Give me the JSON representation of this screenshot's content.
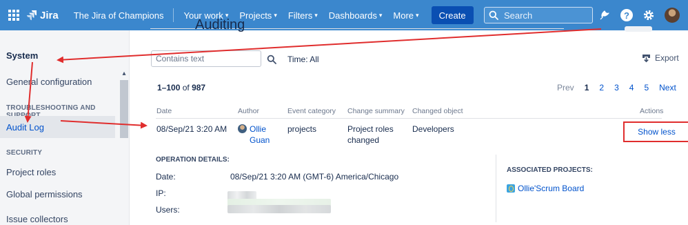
{
  "topnav": {
    "product": "Jira",
    "site_title": "The Jira of Champions",
    "menu": [
      {
        "label": "Your work"
      },
      {
        "label": "Projects"
      },
      {
        "label": "Filters"
      },
      {
        "label": "Dashboards"
      },
      {
        "label": "More"
      }
    ],
    "create_label": "Create",
    "search_placeholder": "Search",
    "icons": [
      "apps-grid-icon",
      "jira-logo-icon",
      "notifications-icon",
      "help-icon",
      "settings-icon",
      "user-avatar"
    ],
    "colors": {
      "bar": "#3b87cd",
      "create": "#0a4fb2"
    }
  },
  "sidebar": {
    "title": "System",
    "items": [
      {
        "label": "General configuration"
      },
      {
        "section": "TROUBLESHOOTING AND SUPPORT"
      },
      {
        "label": "Audit Log",
        "active": true
      },
      {
        "section": "SECURITY"
      },
      {
        "label": "Project roles"
      },
      {
        "label": "Global permissions"
      },
      {
        "label": "Issue collectors"
      }
    ]
  },
  "main": {
    "page_title_peek": "Auditing",
    "filter_placeholder": "Contains text",
    "time_filter": "Time: All",
    "export_label": "Export",
    "count_range": "1–100",
    "count_of": "of",
    "count_total": "987",
    "pagination": {
      "prev": "Prev",
      "pages": [
        "1",
        "2",
        "3",
        "4",
        "5"
      ],
      "current": "1",
      "next": "Next"
    },
    "columns": [
      "Date",
      "Author",
      "Event category",
      "Change summary",
      "Changed object",
      "Actions"
    ],
    "row": {
      "date": "08/Sep/21 3:20 AM",
      "author_line1": "Ollie",
      "author_line2": "Guan",
      "event_category": "projects",
      "change_summary_line1": "Project roles",
      "change_summary_line2": "changed",
      "changed_object": "Developers",
      "action": "Show less"
    },
    "operation_details": {
      "heading": "OPERATION DETAILS:",
      "date_label": "Date:",
      "date_value": "08/Sep/21 3:20 AM (GMT-6) America/Chicago",
      "ip_label": "IP:",
      "users_label": "Users:"
    },
    "associated_projects": {
      "heading": "ASSOCIATED PROJECTS:",
      "items": [
        "Ollie'Scrum Board"
      ]
    }
  },
  "annotations": {
    "arrow_color": "#e02d2d"
  }
}
